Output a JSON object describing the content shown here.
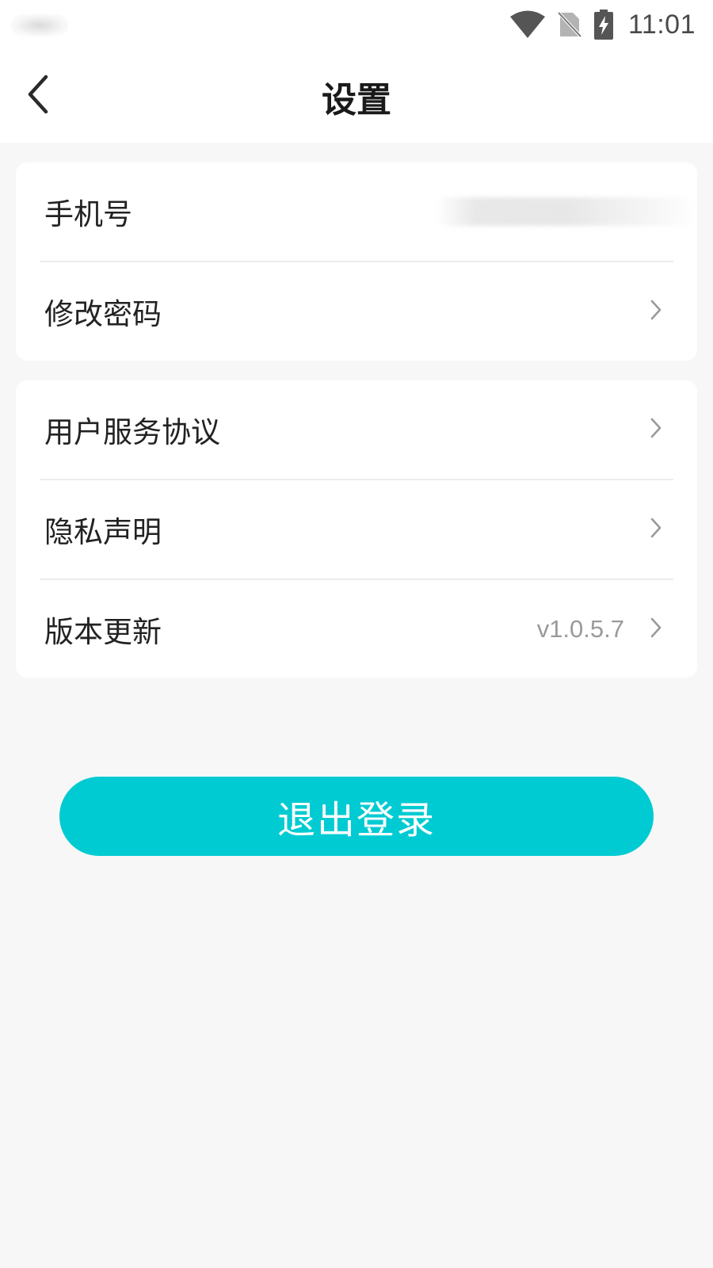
{
  "status_bar": {
    "time": "11:01",
    "icons": [
      "wifi-icon",
      "no-sim-icon",
      "battery-charging-icon"
    ]
  },
  "header": {
    "title": "设置",
    "back_icon": "chevron-left-icon"
  },
  "account_group": {
    "phone_label": "手机号",
    "change_password_label": "修改密码"
  },
  "info_group": {
    "user_agreement_label": "用户服务协议",
    "privacy_label": "隐私声明",
    "version_label": "版本更新",
    "version_value": "v1.0.5.7"
  },
  "logout_label": "退出登录",
  "colors": {
    "accent": "#00cbd2",
    "background": "#f7f7f7",
    "card": "#ffffff",
    "chevron": "#9a9a9a"
  }
}
